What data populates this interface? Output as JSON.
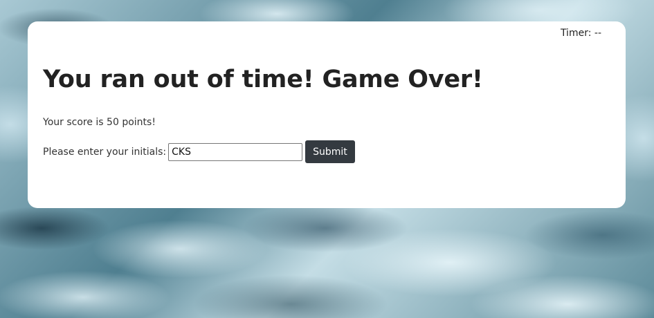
{
  "header": {
    "timer_label": "Timer:",
    "timer_value": "--"
  },
  "main": {
    "title": "You ran out of time! Game Over!",
    "score_prefix": "Your score is",
    "score_value": "50",
    "score_suffix": "points!",
    "initials_label": "Please enter your initials:",
    "initials_value": "CKS",
    "submit_label": "Submit"
  },
  "colors": {
    "card_background": "#ffffff",
    "button_background": "#343a40",
    "button_text": "#ffffff",
    "text": "#222222"
  }
}
